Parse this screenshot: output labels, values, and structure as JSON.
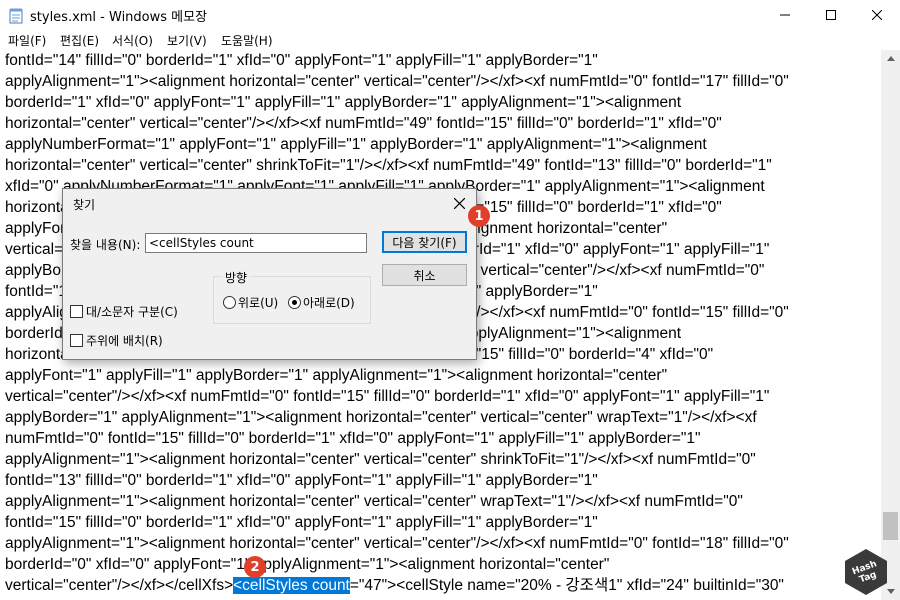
{
  "window": {
    "title": "styles.xml - Windows 메모장"
  },
  "menu": [
    "파일(F)",
    "편집(E)",
    "서식(O)",
    "보기(V)",
    "도움말(H)"
  ],
  "editor": {
    "lines": [
      "fontId=\"14\" fillId=\"0\" borderId=\"1\" xfId=\"0\" applyFont=\"1\" applyFill=\"1\" applyBorder=\"1\"",
      "applyAlignment=\"1\"><alignment horizontal=\"center\" vertical=\"center\"/></xf><xf numFmtId=\"0\" fontId=\"17\" fillId=\"0\"",
      "borderId=\"1\" xfId=\"0\" applyFont=\"1\" applyFill=\"1\" applyBorder=\"1\" applyAlignment=\"1\"><alignment",
      "horizontal=\"center\" vertical=\"center\"/></xf><xf numFmtId=\"49\" fontId=\"15\" fillId=\"0\" borderId=\"1\" xfId=\"0\"",
      "applyNumberFormat=\"1\" applyFont=\"1\" applyFill=\"1\" applyBorder=\"1\" applyAlignment=\"1\"><alignment",
      "horizontal=\"center\" vertical=\"center\" shrinkToFit=\"1\"/></xf><xf numFmtId=\"49\" fontId=\"13\" fillId=\"0\" borderId=\"1\"",
      "xfId=\"0\" applyNumberFormat=\"1\" applyFont=\"1\" applyFill=\"1\" applyBorder=\"1\" applyAlignment=\"1\"><alignment",
      "horizontal=\"center\" vertical=\"center\"/></xf><xf numFmtId=\"49\" fontId=\"15\" fillId=\"0\" borderId=\"1\" xfId=\"0\"",
      "applyFont=\"1\" applyFill=\"1\" applyBorder=\"1\" applyAlignment=\"1\"><alignment horizontal=\"center\"",
      "vertical=\"center\"/></xf><xf numFmtId=\"0\" fontId=\"15\" fillId=\"0\" borderId=\"1\" xfId=\"0\" applyFont=\"1\" applyFill=\"1\"",
      "applyBorder=\"1\" applyAlignment=\"1\"><alignment horizontal=\"center\" vertical=\"center\"/></xf><xf numFmtId=\"0\"",
      "fontId=\"15\" fillId=\"0\" borderId=\"1\" xfId=\"0\" applyFont=\"1\" applyFill=\"1\" applyBorder=\"1\"",
      "applyAlignment=\"1\"><alignment horizontal=\"center\" vertical=\"center\"/></xf><xf numFmtId=\"0\" fontId=\"15\" fillId=\"0\"",
      "borderId=\"1\" xfId=\"0\" applyFont=\"1\" applyFill=\"1\" applyBorder=\"1\" applyAlignment=\"1\"><alignment",
      "horizontal=\"center\" vertical=\"center\"/></xf><xf numFmtId=\"0\" fontId=\"15\" fillId=\"0\" borderId=\"4\" xfId=\"0\"",
      "applyFont=\"1\" applyFill=\"1\" applyBorder=\"1\" applyAlignment=\"1\"><alignment horizontal=\"center\"",
      "vertical=\"center\"/></xf><xf numFmtId=\"0\" fontId=\"15\" fillId=\"0\" borderId=\"1\" xfId=\"0\" applyFont=\"1\" applyFill=\"1\"",
      "applyBorder=\"1\" applyAlignment=\"1\"><alignment horizontal=\"center\" vertical=\"center\" wrapText=\"1\"/></xf><xf",
      "numFmtId=\"0\" fontId=\"15\" fillId=\"0\" borderId=\"1\" xfId=\"0\" applyFont=\"1\" applyFill=\"1\" applyBorder=\"1\"",
      "applyAlignment=\"1\"><alignment horizontal=\"center\" vertical=\"center\" shrinkToFit=\"1\"/></xf><xf numFmtId=\"0\"",
      "fontId=\"13\" fillId=\"0\" borderId=\"1\" xfId=\"0\" applyFont=\"1\" applyFill=\"1\" applyBorder=\"1\"",
      "applyAlignment=\"1\"><alignment horizontal=\"center\" vertical=\"center\" wrapText=\"1\"/></xf><xf numFmtId=\"0\"",
      "fontId=\"15\" fillId=\"0\" borderId=\"1\" xfId=\"0\" applyFont=\"1\" applyFill=\"1\" applyBorder=\"1\"",
      "applyAlignment=\"1\"><alignment horizontal=\"center\" vertical=\"center\"/></xf><xf numFmtId=\"0\" fontId=\"18\" fillId=\"0\"",
      "borderId=\"0\" xfId=\"0\" applyFont=\"1\" applyAlignment=\"1\"><alignment horizontal=\"center\""
    ],
    "last_line_before": "vertical=\"center\"/></xf></cellXfs>",
    "last_line_selected": "<cellStyles count",
    "last_line_after": "=\"47\"><cellStyle name=\"20% - 강조색1\" xfId=\"24\" builtinId=\"30\""
  },
  "find_dialog": {
    "title": "찾기",
    "find_label": "찾을 내용(N):",
    "find_value": "<cellStyles count",
    "find_next_button": "다음 찾기(F)",
    "cancel_button": "취소",
    "direction_label": "방향",
    "direction_up": "위로(U)",
    "direction_down": "아래로(D)",
    "direction_selected": "down",
    "match_case": "대/소문자 구분(C)",
    "wrap_around": "주위에 배치(R)"
  },
  "badges": [
    "1",
    "2"
  ],
  "watermark": "HashTag",
  "colors": {
    "selection": "#0078d7",
    "badge": "#e0402a",
    "dialog_bg": "#f0f0f0"
  }
}
